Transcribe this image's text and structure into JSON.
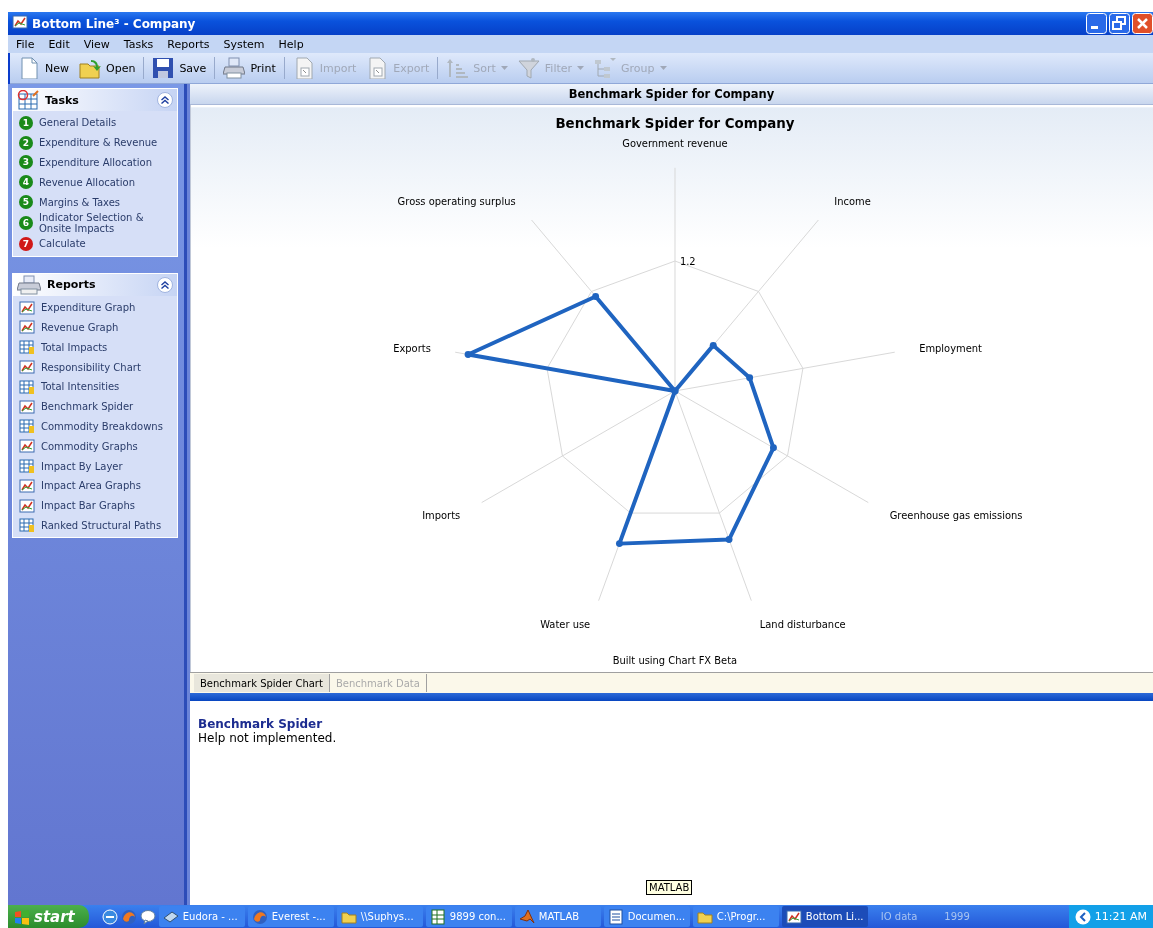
{
  "window": {
    "title": "Bottom Line³ - Company"
  },
  "menu": [
    "File",
    "Edit",
    "View",
    "Tasks",
    "Reports",
    "System",
    "Help"
  ],
  "toolbar": [
    {
      "label": "New",
      "kind": "new",
      "disabled": false,
      "dropdown": false
    },
    {
      "label": "Open",
      "kind": "open",
      "disabled": false,
      "dropdown": false
    },
    {
      "label": "Save",
      "kind": "save",
      "disabled": false,
      "dropdown": false
    },
    {
      "label": "Print",
      "kind": "print",
      "disabled": false,
      "dropdown": false
    },
    {
      "label": "Import",
      "kind": "import",
      "disabled": true,
      "dropdown": false
    },
    {
      "label": "Export",
      "kind": "export",
      "disabled": true,
      "dropdown": false
    },
    {
      "label": "Sort",
      "kind": "sort",
      "disabled": true,
      "dropdown": true
    },
    {
      "label": "Filter",
      "kind": "filter",
      "disabled": true,
      "dropdown": true
    },
    {
      "label": "Group",
      "kind": "group",
      "disabled": true,
      "dropdown": true
    }
  ],
  "sidebar": {
    "panels": [
      {
        "title": "Tasks",
        "kind": "tasks",
        "items": [
          {
            "kind": "step",
            "number": "1",
            "color": "#1a8a1a",
            "label": "General Details"
          },
          {
            "kind": "step",
            "number": "2",
            "color": "#1a8a1a",
            "label": "Expenditure & Revenue"
          },
          {
            "kind": "step",
            "number": "3",
            "color": "#1a8a1a",
            "label": "Expenditure Allocation"
          },
          {
            "kind": "step",
            "number": "4",
            "color": "#1a8a1a",
            "label": "Revenue Allocation"
          },
          {
            "kind": "step",
            "number": "5",
            "color": "#1a8a1a",
            "label": "Margins & Taxes"
          },
          {
            "kind": "step",
            "number": "6",
            "color": "#1a8a1a",
            "label": "Indicator Selection & Onsite Impacts"
          },
          {
            "kind": "step",
            "number": "7",
            "color": "#d01818",
            "label": "Calculate"
          }
        ]
      },
      {
        "title": "Reports",
        "kind": "reports",
        "items": [
          {
            "kind": "chart",
            "label": "Expenditure Graph"
          },
          {
            "kind": "chart",
            "label": "Revenue Graph"
          },
          {
            "kind": "table",
            "label": "Total Impacts"
          },
          {
            "kind": "chart",
            "label": "Responsibility Chart"
          },
          {
            "kind": "table",
            "label": "Total Intensities"
          },
          {
            "kind": "chart",
            "label": "Benchmark Spider"
          },
          {
            "kind": "table",
            "label": "Commodity Breakdowns"
          },
          {
            "kind": "chart",
            "label": "Commodity Graphs"
          },
          {
            "kind": "table",
            "label": "Impact By Layer"
          },
          {
            "kind": "chart",
            "label": "Impact Area Graphs"
          },
          {
            "kind": "chart",
            "label": "Impact Bar Graphs"
          },
          {
            "kind": "table",
            "label": "Ranked Structural Paths"
          }
        ]
      }
    ]
  },
  "content": {
    "header": "Benchmark Spider for Company",
    "spider": {
      "title": "Benchmark Spider for Company",
      "axis_labels": [
        "Government revenue",
        "Gross operating surplus",
        "Income",
        "Exports",
        "Employment",
        "Imports",
        "Greenhouse gas emissions",
        "Water use",
        "Land disturbance"
      ],
      "ring_label": "1.2"
    },
    "chart_footer": "Built using Chart FX Beta",
    "tabs": [
      {
        "label": "Benchmark Spider Chart",
        "selected": true
      },
      {
        "label": "Benchmark Data",
        "selected": false
      }
    ],
    "help": {
      "title": "Benchmark Spider",
      "text": "Help not implemented."
    }
  },
  "taskbar": {
    "start": "start",
    "tasks": [
      {
        "label": "Eudora - ...",
        "kind": "mail",
        "selected": false
      },
      {
        "label": "Everest -...",
        "kind": "browser",
        "selected": false
      },
      {
        "label": "\\\\Suphys...",
        "kind": "folder",
        "selected": false
      },
      {
        "label": "9899 con...",
        "kind": "spreadsheet",
        "selected": false
      },
      {
        "label": "MATLAB",
        "kind": "matlab",
        "selected": false
      },
      {
        "label": "Documen...",
        "kind": "document",
        "selected": false
      },
      {
        "label": "C:\\Progr...",
        "kind": "folder",
        "selected": false
      },
      {
        "label": "Bottom Li...",
        "kind": "chart",
        "selected": true
      }
    ],
    "toolbars": [
      "IO data",
      "1999"
    ],
    "clock": "11:21 AM",
    "tooltip": "MATLAB"
  }
}
